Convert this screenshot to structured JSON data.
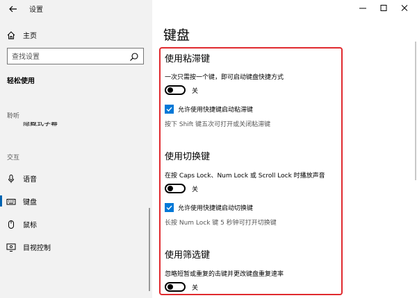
{
  "window": {
    "title": "设置"
  },
  "sidebar": {
    "home_label": "主页",
    "search_placeholder": "查找设置",
    "section_title": "轻松使用",
    "group_hearing": "聆听",
    "cut_item_label": "隐藏式字幕",
    "group_interaction": "交互",
    "items": [
      {
        "label": "语音",
        "icon": "microphone-icon"
      },
      {
        "label": "键盘",
        "icon": "keyboard-icon"
      },
      {
        "label": "鼠标",
        "icon": "mouse-icon"
      },
      {
        "label": "目视控制",
        "icon": "eye-control-icon"
      }
    ],
    "selected_index": 1
  },
  "main": {
    "page_title": "键盘",
    "sticky_keys": {
      "heading": "使用粘滞键",
      "description": "一次只需按一个键，即可启动键盘快捷方式",
      "toggle_state": "关",
      "checkbox_label": "允许使用快捷键启动粘滞键",
      "checkbox_checked": true,
      "hint": "按下 Shift 键五次可打开或关闭粘滞键"
    },
    "toggle_keys": {
      "heading": "使用切换键",
      "description": "在按 Caps Lock、Num Lock 或 Scroll Lock 时播放声音",
      "toggle_state": "关",
      "checkbox_label": "允许使用快捷键启动切换键",
      "checkbox_checked": true,
      "hint": "长按 Num Lock 键 5 秒钟可打开切换键"
    },
    "filter_keys": {
      "heading": "使用筛选键",
      "description": "忽略短暂或重复的击键并更改键盘重复速率",
      "toggle_state": "关"
    }
  },
  "colors": {
    "accent": "#0078d7",
    "highlight_border": "#e0292e",
    "sidebar_bg": "#f2f2f2"
  }
}
